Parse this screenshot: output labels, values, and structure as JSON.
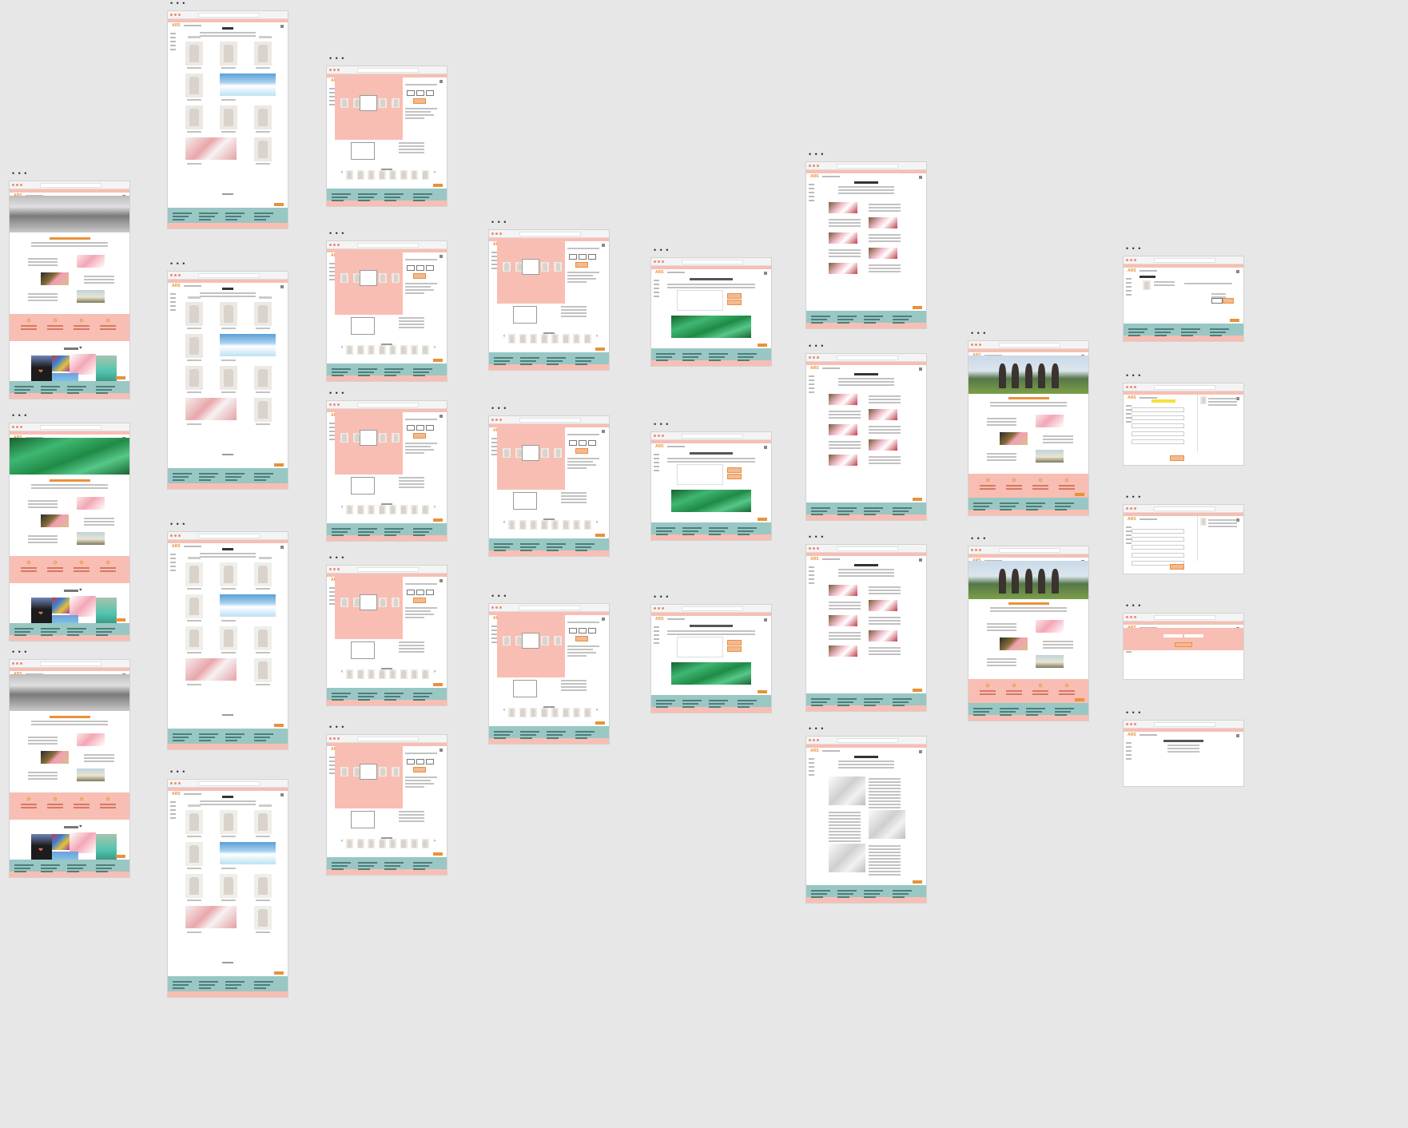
{
  "canvas": {
    "background": "#e7e7e7"
  },
  "colors": {
    "accent": "#e8923a",
    "pink": "#f8beb3",
    "teal": "#98c7c4",
    "footer_text": "#4e7e7b",
    "green_satin": "#3cb878"
  },
  "window_controls": "• • •",
  "brand": {
    "logo_text": "ARS"
  },
  "icons": {
    "feature": "✿",
    "prev_arrow": "‹",
    "next_arrow": "›",
    "heart": "♥",
    "hands_heart": "❤"
  },
  "sections": {
    "screens": [
      {
        "id": "home-light",
        "type": "homepage"
      },
      {
        "id": "home-green",
        "type": "homepage"
      },
      {
        "id": "home-light-2",
        "type": "homepage"
      },
      {
        "id": "gallery-1",
        "type": "product-grid"
      },
      {
        "id": "gallery-2",
        "type": "product-grid"
      },
      {
        "id": "gallery-3",
        "type": "product-grid"
      },
      {
        "id": "gallery-4",
        "type": "product-grid"
      },
      {
        "id": "product-detail",
        "type": "product-detail"
      },
      {
        "id": "cart",
        "type": "cart"
      },
      {
        "id": "checkout",
        "type": "checkout"
      },
      {
        "id": "login",
        "type": "login"
      },
      {
        "id": "thanks",
        "type": "confirmation"
      }
    ]
  }
}
